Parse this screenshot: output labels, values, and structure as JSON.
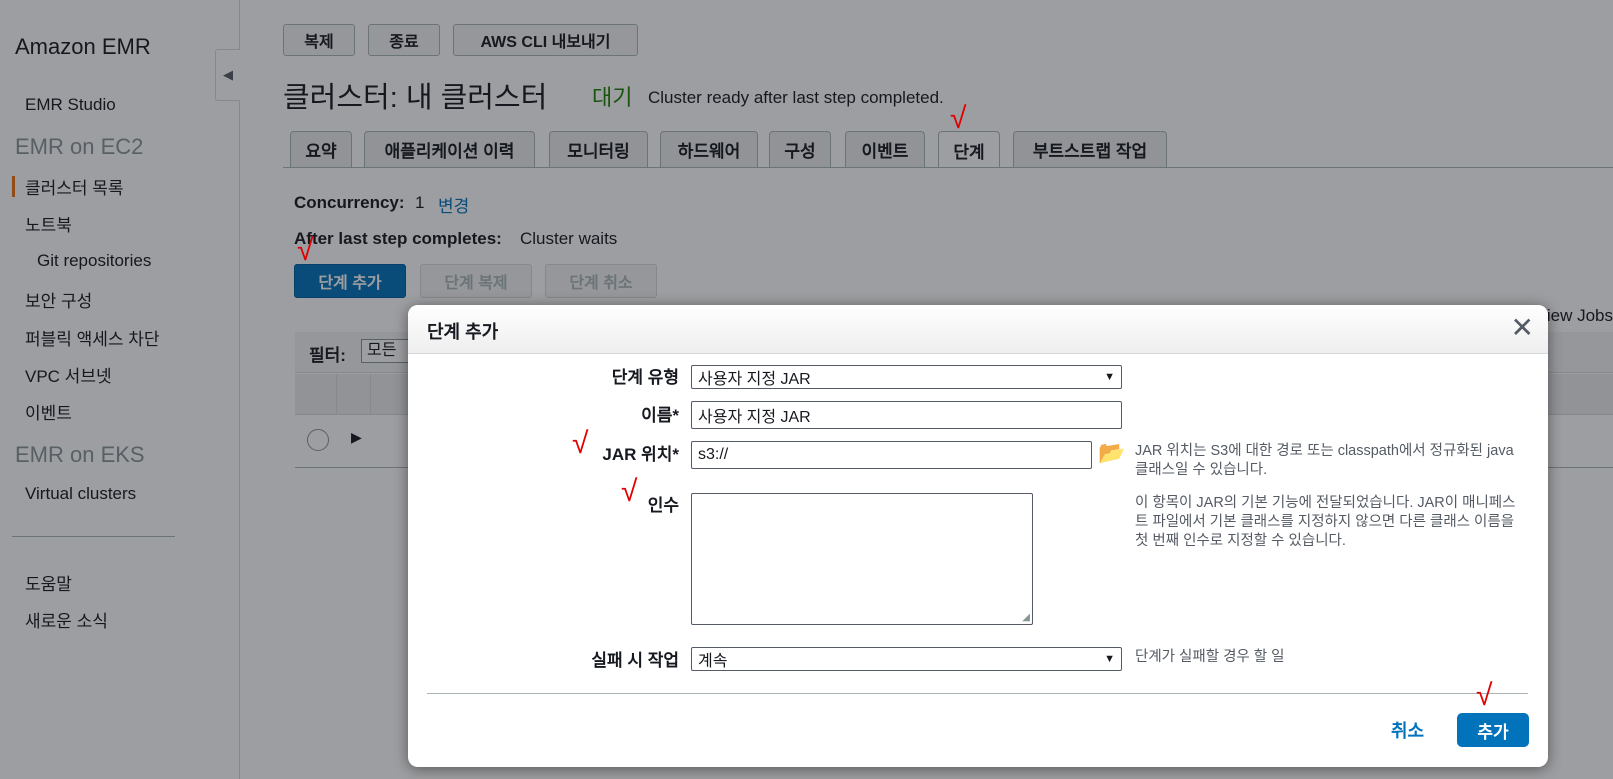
{
  "sidebar": {
    "brand": "Amazon EMR",
    "emr_studio": "EMR Studio",
    "section_ec2": "EMR on EC2",
    "clusters": "클러스터 목록",
    "notebooks": "노트북",
    "git_repos": "Git repositories",
    "security_config": "보안 구성",
    "block_public_access": "퍼블릭 액세스 차단",
    "vpc_subnets": "VPC 서브넷",
    "events": "이벤트",
    "section_eks": "EMR on EKS",
    "virtual_clusters": "Virtual clusters",
    "help": "도움말",
    "whats_new": "새로운 소식"
  },
  "toolbar": {
    "clone": "복제",
    "terminate": "종료",
    "aws_cli_export": "AWS CLI 내보내기"
  },
  "header": {
    "title": "클러스터: 내 클러스터",
    "status": "대기",
    "status_desc": "Cluster ready after last step completed."
  },
  "tabs": [
    "요약",
    "애플리케이션 이력",
    "모니터링",
    "하드웨어",
    "구성",
    "이벤트",
    "단계",
    "부트스트랩 작업"
  ],
  "active_tab": "단계",
  "steps": {
    "concurrency_label": "Concurrency:",
    "concurrency_value": "1",
    "concurrency_change": "변경",
    "after_last_label": "After last step completes:",
    "after_last_value": "Cluster waits",
    "add_step": "단계 추가",
    "clone_step": "단계 복제",
    "cancel_step": "단계 취소",
    "filter_label": "필터:",
    "filter_value": "모든",
    "view_jobs": "View Jobs"
  },
  "modal": {
    "title": "단계 추가",
    "step_type_label": "단계 유형",
    "step_type_value": "사용자 지정 JAR",
    "name_label": "이름*",
    "name_value": "사용자 지정 JAR",
    "jar_label": "JAR 위치*",
    "jar_value": "s3://",
    "jar_help": "JAR 위치는 S3에 대한 경로 또는 classpath에서 정규화된 java 클래스일 수 있습니다.",
    "args_label": "인수",
    "args_value": "",
    "args_help": "이 항목이 JAR의 기본 기능에 전달되었습니다. JAR이 매니페스트 파일에서 기본 클래스를 지정하지 않으면 다른 클래스 이름을 첫 번째 인수로 지정할 수 있습니다.",
    "failure_label": "실패 시 작업",
    "failure_value": "계속",
    "failure_help": "단계가 실패할 경우 할 일",
    "cancel": "취소",
    "add": "추가"
  },
  "annotations": {
    "check_mark": "√"
  },
  "colors": {
    "primary": "#0073bb",
    "status_green": "#1d8102",
    "accent_orange": "#ec7211",
    "annotation_red": "#e00000"
  }
}
